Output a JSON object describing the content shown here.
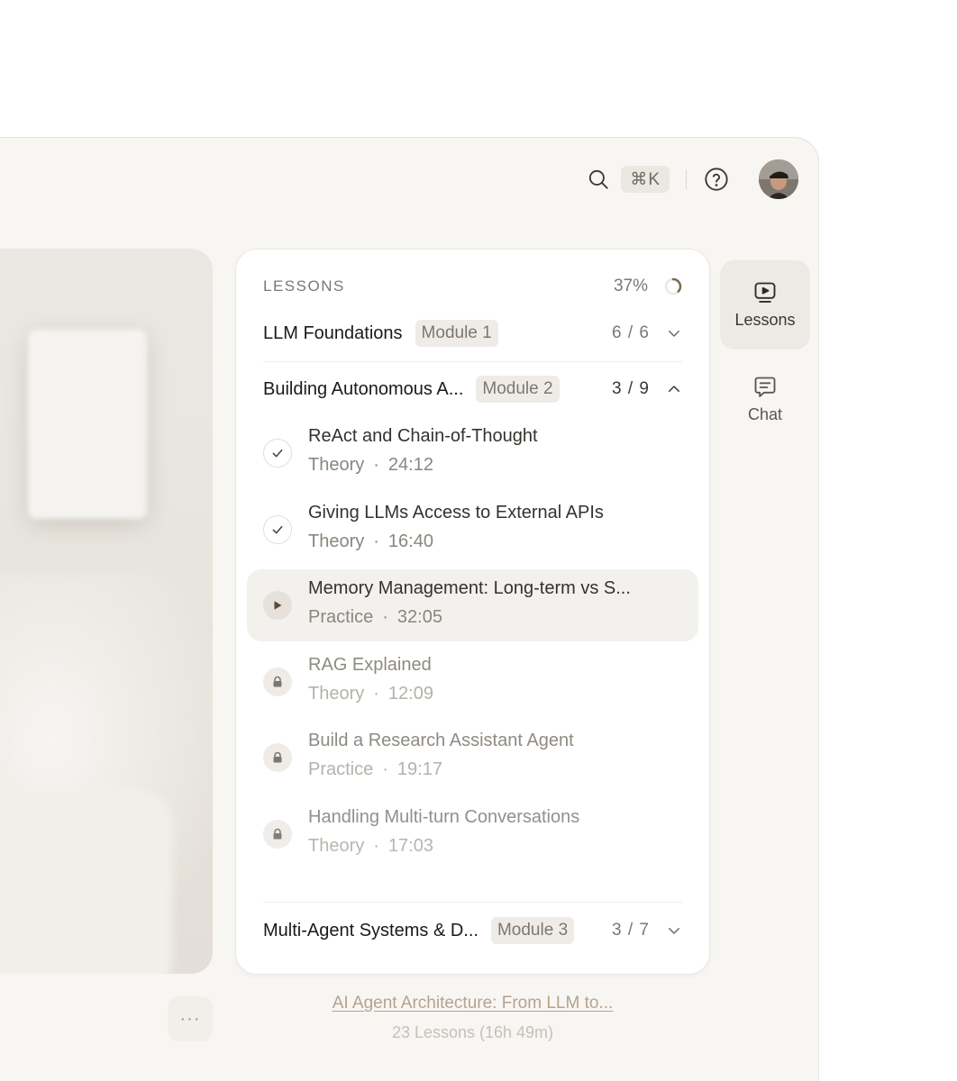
{
  "topbar": {
    "shortcut": "⌘K",
    "search_icon": "search-icon",
    "help_icon": "help-circle-icon"
  },
  "panel": {
    "label": "LESSONS",
    "progress_pct": "37%",
    "progress_value": 0.37
  },
  "modules": [
    {
      "title": "LLM Foundations",
      "badge": "Module 1",
      "count": "6 / 6",
      "expanded": false
    },
    {
      "title": "Building Autonomous A...",
      "badge": "Module 2",
      "count": "3 / 9",
      "expanded": true
    },
    {
      "title": "Multi-Agent Systems & D...",
      "badge": "Module 3",
      "count": "3 / 7",
      "expanded": false
    }
  ],
  "lessons": [
    {
      "title": "ReAct and Chain-of-Thought",
      "type": "Theory",
      "duration": "24:12",
      "status": "done"
    },
    {
      "title": "Giving LLMs Access to External APIs",
      "type": "Theory",
      "duration": "16:40",
      "status": "done"
    },
    {
      "title": "Memory Management: Long-term vs S...",
      "type": "Practice",
      "duration": "32:05",
      "status": "playing"
    },
    {
      "title": "RAG Explained",
      "type": "Theory",
      "duration": "12:09",
      "status": "locked"
    },
    {
      "title": "Build a Research Assistant Agent",
      "type": "Practice",
      "duration": "19:17",
      "status": "locked"
    },
    {
      "title": "Handling Multi-turn Conversations",
      "type": "Theory",
      "duration": "17:03",
      "status": "locked"
    }
  ],
  "rail": {
    "lessons_label": "Lessons",
    "chat_label": "Chat"
  },
  "course": {
    "title": "AI Agent Architecture: From LLM to...",
    "meta": "23 Lessons (16h 49m)",
    "more_label": "···"
  },
  "colors": {
    "accent": "#b3a48e",
    "window_bg": "#f8f6f3",
    "active_row": "#f3f1ee"
  }
}
